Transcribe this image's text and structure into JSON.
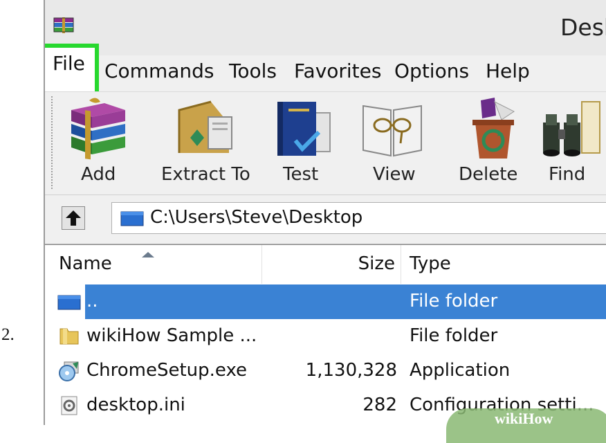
{
  "step_number": "2.",
  "window": {
    "title": "Desk",
    "app_icon": "winrar-books-icon"
  },
  "menubar": {
    "items": [
      "File",
      "Commands",
      "Tools",
      "Favorites",
      "Options",
      "Help"
    ],
    "highlighted": "File",
    "highlight_color": "#27d82e"
  },
  "toolbar": {
    "buttons": [
      {
        "label": "Add",
        "icon": "archive-books-icon"
      },
      {
        "label": "Extract To",
        "icon": "extract-folder-icon"
      },
      {
        "label": "Test",
        "icon": "test-book-check-icon"
      },
      {
        "label": "View",
        "icon": "view-glasses-book-icon"
      },
      {
        "label": "Delete",
        "icon": "delete-recycle-icon"
      },
      {
        "label": "Find",
        "icon": "find-binoculars-icon"
      }
    ]
  },
  "addressbar": {
    "up_icon": "up-arrow-icon",
    "folder_icon": "folder-icon",
    "path": "C:\\Users\\Steve\\Desktop"
  },
  "filelist": {
    "columns": {
      "name": "Name",
      "size": "Size",
      "type": "Type"
    },
    "sort_column": "Name",
    "rows": [
      {
        "name": "..",
        "size": "",
        "type": "File folder",
        "icon": "folder-icon",
        "selected": true
      },
      {
        "name": "wikiHow Sample ...",
        "size": "",
        "type": "File folder",
        "icon": "yellow-folder-icon",
        "selected": false
      },
      {
        "name": "ChromeSetup.exe",
        "size": "1,130,328",
        "type": "Application",
        "icon": "installer-icon",
        "selected": false
      },
      {
        "name": "desktop.ini",
        "size": "282",
        "type": "Configuration setti...",
        "icon": "settings-file-icon",
        "selected": false
      }
    ],
    "selection_color": "#3a82d4"
  },
  "watermark": "wikiHow"
}
